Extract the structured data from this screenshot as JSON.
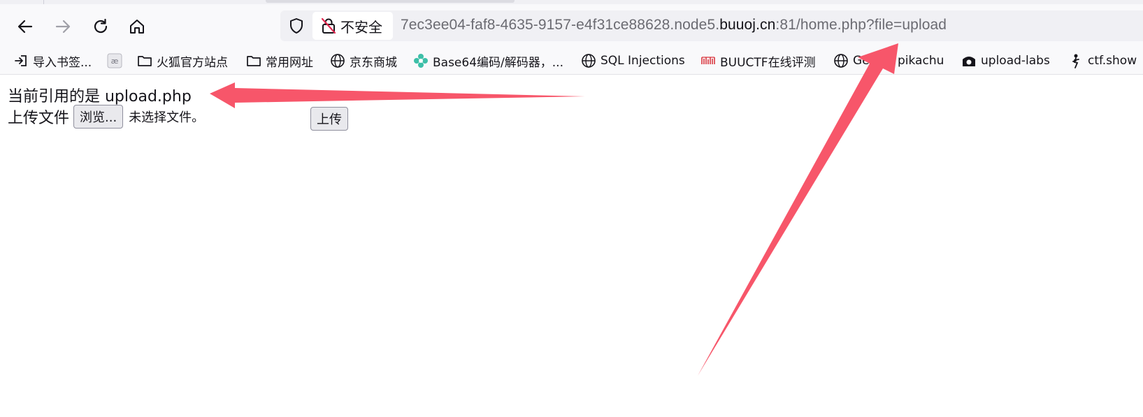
{
  "browser": {
    "security_label": "不安全",
    "url": {
      "prefix": "7ec3ee04-faf8-4635-9157-e4f31ce88628.node5.",
      "domain": "buuoj.cn",
      "suffix": ":81/home.php?file=upload"
    }
  },
  "bookmarks": {
    "items": [
      {
        "label": "导入书签...",
        "icon": "import-icon"
      },
      {
        "label": "",
        "icon": "ae-icon"
      },
      {
        "label": "火狐官方站点",
        "icon": "folder-icon"
      },
      {
        "label": "常用网址",
        "icon": "folder-icon"
      },
      {
        "label": "京东商城",
        "icon": "globe-icon"
      },
      {
        "label": "Base64编码/解码器，...",
        "icon": "flower-icon"
      },
      {
        "label": "SQL Injections",
        "icon": "globe-icon"
      },
      {
        "label": "BUUCTF在线评测",
        "icon": "buuctf-icon"
      },
      {
        "label": "Get",
        "icon": "globe-icon"
      },
      {
        "label": "pikachu",
        "icon": "none"
      },
      {
        "label": "upload-labs",
        "icon": "upload-labs-icon"
      },
      {
        "label": "ctf.show",
        "icon": "ctfshow-icon"
      }
    ]
  },
  "page": {
    "current_include": "当前引用的是 upload.php",
    "upload_label": "上传文件",
    "browse_button": "浏览...",
    "no_file_text": "未选择文件。",
    "submit_button": "上传"
  },
  "colors": {
    "annotation_arrow": "#f7566a"
  }
}
